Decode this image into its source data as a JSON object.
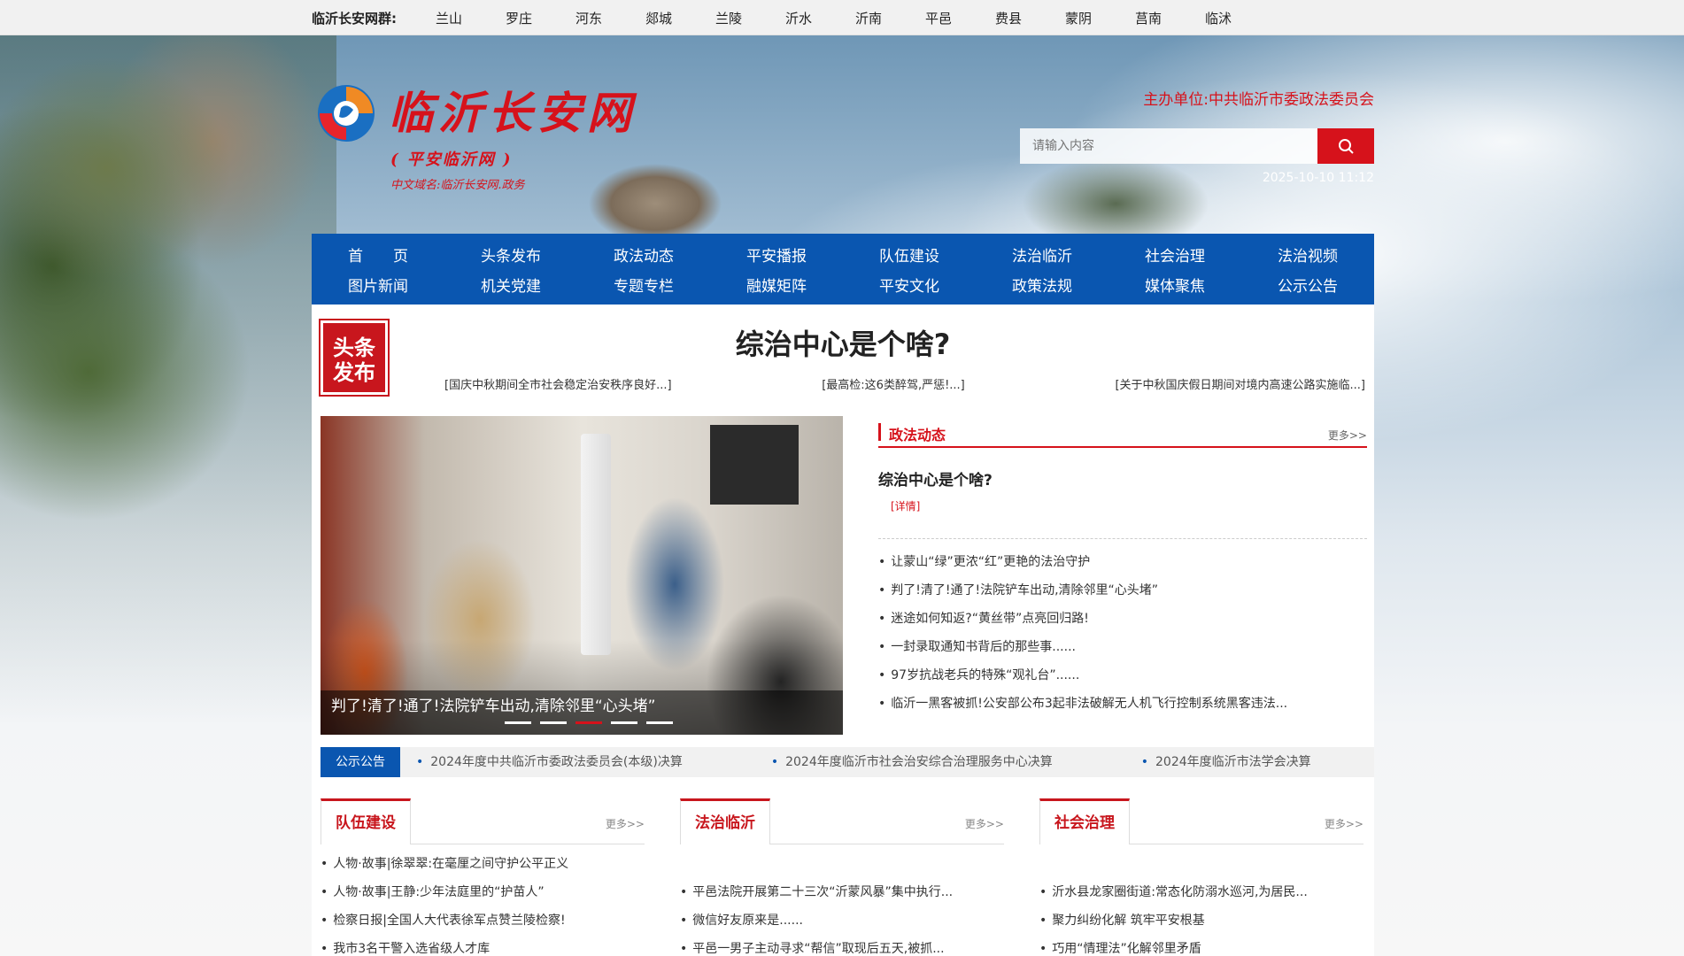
{
  "topbar": {
    "label": "临沂长安网群:",
    "links": [
      "兰山",
      "罗庄",
      "河东",
      "郯城",
      "兰陵",
      "沂水",
      "沂南",
      "平邑",
      "费县",
      "蒙阴",
      "莒南",
      "临沭"
    ]
  },
  "header": {
    "logo_title": "临沂长安网",
    "logo_sub": "( 平安临沂网 )",
    "logo_domain": "中文域名:临沂长安网.政务",
    "sponsor": "主办单位:中共临沂市委政法委员会",
    "search_placeholder": "请输入内容",
    "datetime": "2025-10-10 11:12"
  },
  "nav": {
    "row1": [
      "首　　页",
      "头条发布",
      "政法动态",
      "平安播报",
      "队伍建设",
      "法治临沂",
      "社会治理",
      "法治视频"
    ],
    "row2": [
      "图片新闻",
      "机关党建",
      "专题专栏",
      "融媒矩阵",
      "平安文化",
      "政策法规",
      "媒体聚焦",
      "公示公告"
    ]
  },
  "headline": {
    "badge": "头条发布",
    "badge_line1": "头条",
    "badge_line2": "发布",
    "title": "综治中心是个啥?",
    "links": [
      "[国庆中秋期间全市社会稳定治安秩序良好...]",
      "[最高检:这6类醉驾,严惩!...]",
      "[关于中秋国庆假日期间对境内高速公路实施临...]"
    ]
  },
  "slider": {
    "caption": "判了!清了!通了!法院铲车出动,清除邻里“心头堵”",
    "dots": 5,
    "active": 3
  },
  "politics": {
    "title": "政法动态",
    "more": "更多>>",
    "feature_title": "综治中心是个啥?",
    "feature_detail": "[详情]",
    "items": [
      "让蒙山“绿”更浓“红”更艳的法治守护",
      "判了!清了!通了!法院铲车出动,清除邻里“心头堵”",
      "迷途如何知返?“黄丝带”点亮回归路!",
      "一封录取通知书背后的那些事......",
      "97岁抗战老兵的特殊“观礼台”......",
      "临沂一黑客被抓!公安部公布3起非法破解无人机飞行控制系统黑客违法..."
    ]
  },
  "notice": {
    "tag": "公示公告",
    "items": [
      "2024年度中共临沂市委政法委员会(本级)决算",
      "2024年度临沂市社会治安综合治理服务中心决算",
      "2024年度临沂市法学会决算"
    ]
  },
  "columns": [
    {
      "title": "队伍建设",
      "more": "更多>>",
      "items": [
        "人物·故事|徐翠翠:在毫厘之间守护公平正义",
        "人物·故事|王静:少年法庭里的“护苗人”",
        "检察日报|全国人大代表徐军点赞兰陵检察!",
        "我市3名干警入选省级人才库"
      ]
    },
    {
      "title": "法治临沂",
      "more": "更多>>",
      "items": [
        "",
        "平邑法院开展第二十三次“沂蒙风暴”集中执行...",
        "微信好友原来是......",
        "平邑一男子主动寻求“帮信”取现后五天,被抓..."
      ]
    },
    {
      "title": "社会治理",
      "more": "更多>>",
      "items": [
        "",
        "沂水县龙家圈街道:常态化防溺水巡河,为居民...",
        "聚力纠纷化解 筑牢平安根基",
        "巧用“情理法”化解邻里矛盾"
      ]
    }
  ],
  "colors": {
    "brand_red": "#d6121b",
    "nav_blue": "#0a56b0"
  }
}
